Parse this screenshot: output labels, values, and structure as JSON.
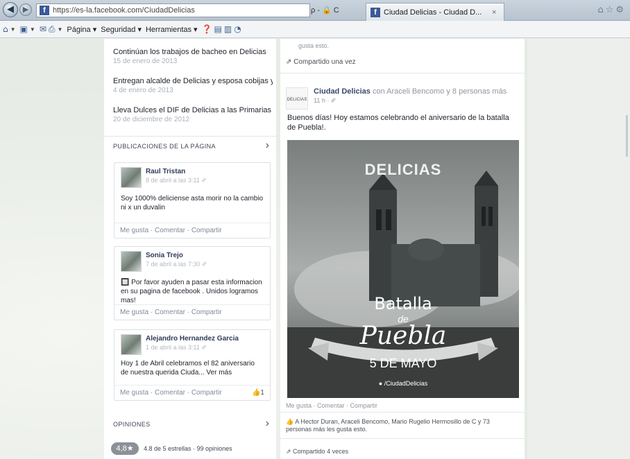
{
  "browser": {
    "url": "https://es-la.facebook.com/CiudadDelicias",
    "addr_tools": "ρ - 🔒 C",
    "tab_title": "Ciudad Delicias - Ciudad D...",
    "tab_close": "×",
    "back_icon": "back-arrow-icon",
    "forward_icon": "forward-arrow-icon"
  },
  "commandbar": {
    "items": [
      "Página ▾",
      "Seguridad ▾",
      "Herramientas ▾"
    ]
  },
  "left": {
    "trending": [
      {
        "title": "Continúan los trabajos de bacheo en Delicias",
        "date": "15 de enero de 2013"
      },
      {
        "title": "Entregan alcalde de Delicias y esposa cobijas y cham...",
        "date": "4 de enero de 2013"
      },
      {
        "title": "Lleva Dulces el DIF de Delicias a las Primarias",
        "date": "20 de diciembre de 2012"
      }
    ],
    "publicaciones_label": "PUBLICACIONES DE LA PÁGINA",
    "chevron": "›",
    "posts": [
      {
        "name": "Raul Tristan",
        "time": "8 de abril a las 3:11 ✐",
        "text": "Soy 1000% deliciense asta morir no la cambio ni x un duvalin",
        "actions": "Me gusta · Comentar · Compartir",
        "likes": ""
      },
      {
        "name": "Sonia Trejo",
        "time": "7 de abril a las 7:30 ✐",
        "text": "🔲 Por favor ayuden a pasar esta informacion en su pagina de facebook . Unidos logramos mas!",
        "actions": "Me gusta · Comentar · Compartir",
        "likes": ""
      },
      {
        "name": "Alejandro Hernandez Garcia",
        "time": "1 de abril a las 3:11 ✐",
        "text": "Hoy 1 de Abril celebramos el 82 aniversario de nuestra querida Ciuda... Ver más",
        "actions": "Me gusta · Comentar · Compartir",
        "likes": "👍1"
      }
    ],
    "opiniones_label": "OPINIONES",
    "rating": "4,8★",
    "rating_text": "4.8 de 5 estrellas · 99 opiniones"
  },
  "right": {
    "top_text": "gusta esto.",
    "shared_once": "Compartido una vez",
    "page_name": "Ciudad Delicias",
    "with_text": "con Araceli Bencomo y 8 personas más",
    "time": "11 h · ✐",
    "logo_text": "DELICIAS",
    "post_body": "Buenos días! Hoy estamos celebrando el aniversario de la batalla de Puebla!.",
    "image": {
      "brand": "DELICIAS",
      "line1": "Batalla",
      "line2": "de",
      "line3": "Puebla",
      "date": "5 DE MAYO",
      "handle": "/CiudadDelicias"
    },
    "actions": "Me gusta · Comentar · Compartir",
    "likes_line": "A Hector Duran, Araceli Bencomo, Mario Rugelio Hermosillo de C y 73 personas más les gusta esto.",
    "shared_times": "Compartido 4 veces"
  }
}
